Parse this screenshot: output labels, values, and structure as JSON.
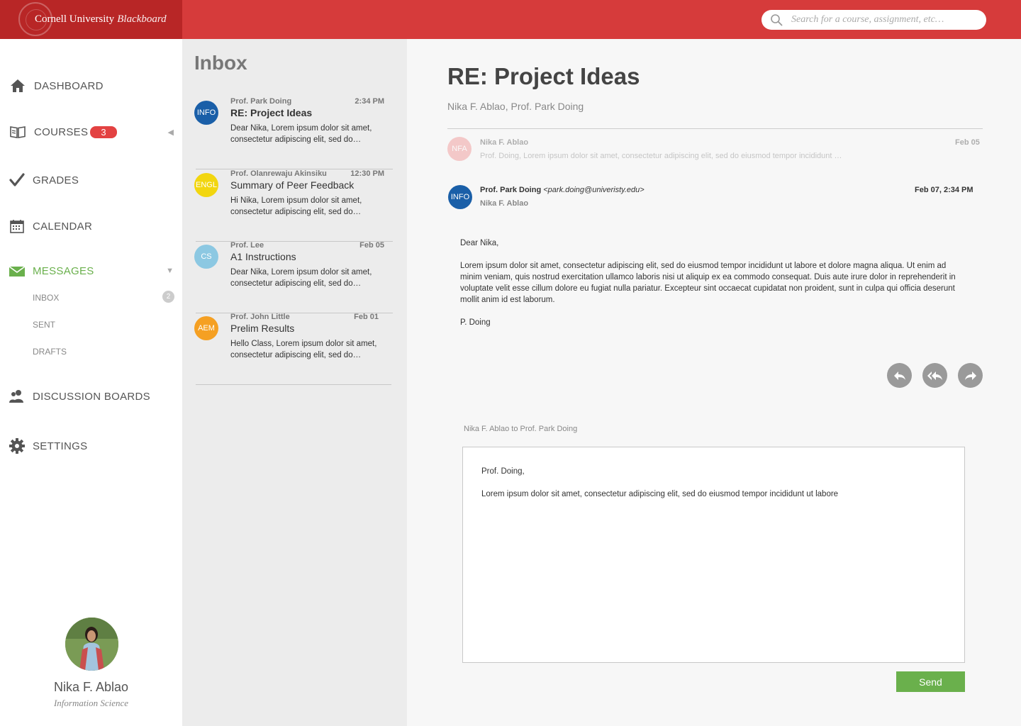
{
  "brand": {
    "university": "Cornell University",
    "product": "Blackboard"
  },
  "search": {
    "placeholder": "Search for a course, assignment, etc…"
  },
  "nav": {
    "dashboard": "DASHBOARD",
    "courses": "COURSES",
    "courses_badge": "3",
    "grades": "GRADES",
    "calendar": "CALENDAR",
    "messages": "MESSAGES",
    "inbox": "INBOX",
    "inbox_count": "2",
    "sent": "SENT",
    "drafts": "DRAFTS",
    "discussion_boards": "DISCUSSION BOARDS",
    "settings": "SETTINGS"
  },
  "user": {
    "name": "Nika F. Ablao",
    "department": "Information Science"
  },
  "inbox": {
    "title": "Inbox",
    "messages": [
      {
        "tag": "INFO",
        "tag_color": "#1a5fa8",
        "from": "Prof. Park Doing",
        "time": "2:34 PM",
        "subject": "RE: Project Ideas",
        "preview": "Dear Nika, Lorem ipsum dolor sit amet, consectetur adipiscing elit, sed do…"
      },
      {
        "tag": "ENGL",
        "tag_color": "#f2d60f",
        "from": "Prof. Olanrewaju Akinsiku",
        "time": "12:30 PM",
        "subject": "Summary of Peer Feedback",
        "preview": "Hi Nika, Lorem ipsum dolor sit amet, consectetur adipiscing elit, sed do…"
      },
      {
        "tag": "CS",
        "tag_color": "#8cc8e2",
        "from": "Prof. Lee",
        "time": "Feb 05",
        "subject": "A1 Instructions",
        "preview": "Dear Nika, Lorem ipsum dolor sit amet, consectetur adipiscing elit, sed do…"
      },
      {
        "tag": "AEM",
        "tag_color": "#f5a023",
        "from": "Prof. John Little",
        "time": "Feb 01",
        "subject": "Prelim Results",
        "preview": "Hello Class, Lorem ipsum dolor sit amet, consectetur adipiscing elit, sed do…"
      }
    ]
  },
  "thread": {
    "subject": "RE: Project Ideas",
    "participants": "Nika F. Ablao, Prof. Park Doing",
    "collapsed": {
      "tag": "NFA",
      "tag_color": "#f09090",
      "from": "Nika F. Ablao",
      "preview": "Prof. Doing, Lorem ipsum dolor sit amet, consectetur adipiscing elit, sed do eiusmod tempor incididunt …",
      "date": "Feb 05"
    },
    "open": {
      "tag": "INFO",
      "tag_color": "#1a5fa8",
      "from": "Prof. Park Doing",
      "email": "<park.doing@univeristy.edu>",
      "to": "Nika F. Ablao",
      "date": "Feb 07, 2:34 PM",
      "greeting": "Dear Nika,",
      "body": "Lorem ipsum dolor sit amet, consectetur adipiscing elit, sed do eiusmod tempor incididunt ut labore et dolore magna aliqua. Ut enim ad minim veniam, quis nostrud exercitation ullamco laboris nisi ut aliquip ex ea commodo consequat. Duis aute irure dolor in reprehenderit in voluptate velit esse cillum dolore eu fugiat nulla pariatur. Excepteur sint occaecat cupidatat non proident, sunt in culpa qui officia deserunt mollit anim id est laborum.",
      "signature": "P. Doing"
    }
  },
  "actions": {
    "reply": "reply-icon",
    "reply_all": "reply-all-icon",
    "forward": "forward-icon"
  },
  "reply": {
    "header": "Nika F. Ablao to Prof. Park Doing",
    "draft": "Prof. Doing,\n\nLorem ipsum dolor sit amet, consectetur adipiscing elit, sed do eiusmod tempor incididunt ut labore",
    "send_label": "Send"
  },
  "colors": {
    "brand_red": "#d63b3b",
    "brand_dark_red": "#b82626",
    "accent_green": "#6ab04c",
    "badge_red": "#e34242"
  }
}
